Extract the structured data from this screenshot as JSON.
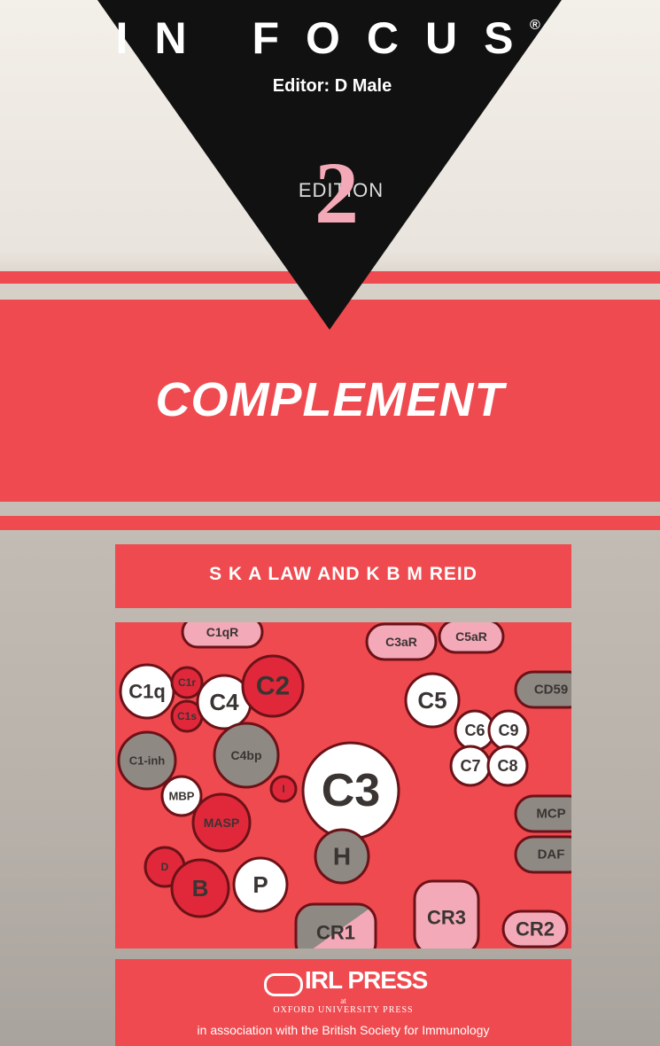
{
  "cover": {
    "series": "IN FOCUS",
    "registered_mark": "®",
    "editor": "Editor: D Male",
    "edition_number": "2",
    "edition_word": "EDITION",
    "title": "COMPLEMENT",
    "authors": "S K A LAW AND K B M REID",
    "publisher": {
      "logo": "IRL PRESS",
      "at": "at",
      "imprint": "OXFORD UNIVERSITY PRESS",
      "association": "in association with the British Society for Immunology"
    }
  },
  "colors": {
    "cover_red": "#ef4a4f",
    "dark_red": "#e0283a",
    "pink": "#f4a9b8",
    "grey": "#8f8983",
    "white": "#ffffff",
    "outline": "#6b1218",
    "text_dark": "#3a3433"
  },
  "diagram": {
    "components": [
      {
        "label": "C1qR",
        "shape": "pill",
        "fill": "pink"
      },
      {
        "label": "C3aR",
        "shape": "pill",
        "fill": "pink"
      },
      {
        "label": "C5aR",
        "shape": "pill",
        "fill": "pink"
      },
      {
        "label": "C1q",
        "shape": "circle",
        "fill": "white"
      },
      {
        "label": "C1r",
        "shape": "circle",
        "fill": "red"
      },
      {
        "label": "C1s",
        "shape": "circle",
        "fill": "red"
      },
      {
        "label": "C4",
        "shape": "circle",
        "fill": "white"
      },
      {
        "label": "C2",
        "shape": "circle",
        "fill": "red"
      },
      {
        "label": "C1-inh",
        "shape": "circle",
        "fill": "grey"
      },
      {
        "label": "C4bp",
        "shape": "circle",
        "fill": "grey"
      },
      {
        "label": "MBP",
        "shape": "circle",
        "fill": "white"
      },
      {
        "label": "MASP",
        "shape": "circle",
        "fill": "red"
      },
      {
        "label": "I",
        "shape": "circle",
        "fill": "red"
      },
      {
        "label": "C3",
        "shape": "circle",
        "fill": "white"
      },
      {
        "label": "H",
        "shape": "circle",
        "fill": "grey"
      },
      {
        "label": "D",
        "shape": "circle",
        "fill": "red"
      },
      {
        "label": "B",
        "shape": "circle",
        "fill": "red"
      },
      {
        "label": "P",
        "shape": "circle",
        "fill": "white"
      },
      {
        "label": "CR1",
        "shape": "pill",
        "fill": "grey-pink"
      },
      {
        "label": "CR3",
        "shape": "pill",
        "fill": "pink"
      },
      {
        "label": "CR2",
        "shape": "pill",
        "fill": "pink"
      },
      {
        "label": "C5",
        "shape": "circle",
        "fill": "white"
      },
      {
        "label": "C6",
        "shape": "circle",
        "fill": "white"
      },
      {
        "label": "C9",
        "shape": "circle",
        "fill": "white"
      },
      {
        "label": "C7",
        "shape": "circle",
        "fill": "white"
      },
      {
        "label": "C8",
        "shape": "circle",
        "fill": "white"
      },
      {
        "label": "CD59",
        "shape": "pill",
        "fill": "grey"
      },
      {
        "label": "MCP",
        "shape": "pill",
        "fill": "grey"
      },
      {
        "label": "DAF",
        "shape": "pill",
        "fill": "grey"
      }
    ]
  }
}
